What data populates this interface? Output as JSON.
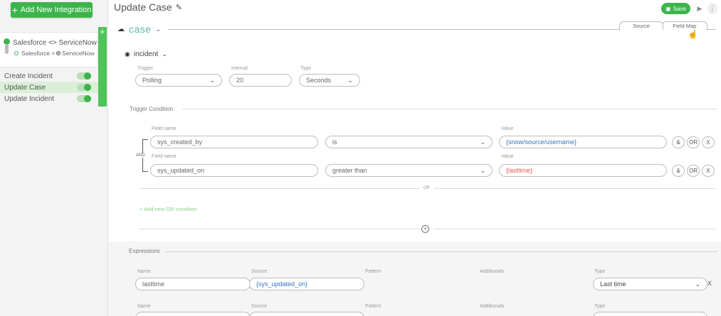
{
  "sidebar": {
    "add_button_label": "Add New Integration",
    "integration": {
      "title": "Salesforce <> ServiceNow",
      "source": "Salesforce",
      "sep": ">",
      "target": "ServiceNow"
    },
    "flows": [
      {
        "label": "Create Incident"
      },
      {
        "label": "Update Case"
      },
      {
        "label": "Update Incident"
      }
    ]
  },
  "header": {
    "title": "Update Case",
    "save_label": "Save"
  },
  "object": {
    "name": "case",
    "tabs": [
      "Source",
      "Field Map"
    ],
    "source_object": "incident"
  },
  "trigger": {
    "trigger_label": "Trigger",
    "trigger_value": "Polling",
    "interval_label": "Interval",
    "interval_value": "20",
    "type_label": "Type",
    "type_value": "Seconds"
  },
  "trigger_condition": {
    "section_label": "Trigger Condition",
    "field_name_label": "Field name",
    "value_label": "Value",
    "and_label": "AND",
    "or_label": "OR",
    "add_or_label": "+ Add new OR condition",
    "conditions": [
      {
        "field": "sys_created_by",
        "operator": "is",
        "value": "{snow/source/username}"
      },
      {
        "field": "sys_updated_on",
        "operator": "greater than",
        "value": "{lasttime}"
      }
    ],
    "buttons": [
      "&",
      "OR",
      "X"
    ]
  },
  "expressions": {
    "section_label": "Expressions",
    "headers": [
      "Name",
      "Source",
      "Pattern",
      "Additionals",
      "Type"
    ],
    "rows": [
      {
        "name": "lasttime",
        "source": "{sys_updated_on}",
        "type": "Last time"
      }
    ]
  }
}
